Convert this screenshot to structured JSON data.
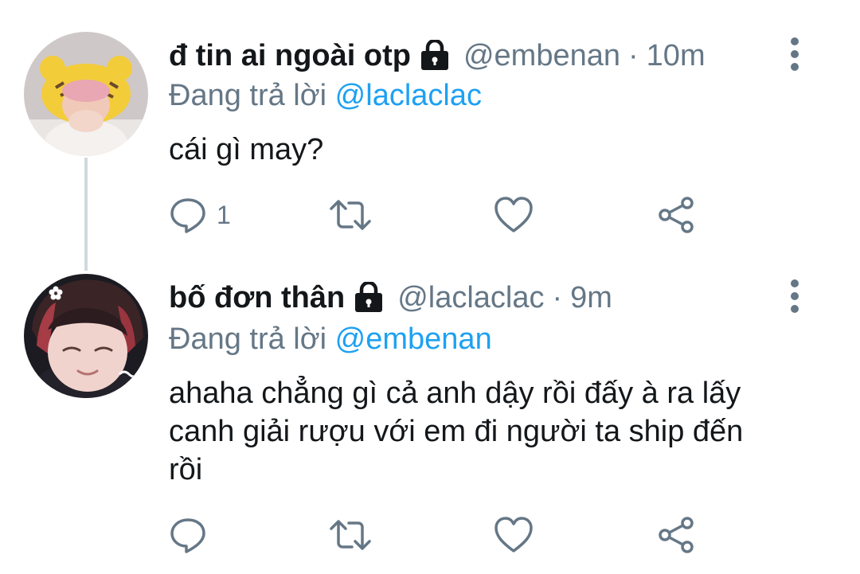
{
  "tweets": [
    {
      "display_name": "đ tin ai ngoài otp",
      "handle": "@embenan",
      "separator": "·",
      "time": "10m",
      "reply_prefix": "Đang trả lời",
      "reply_to": "@laclaclac",
      "text": "cái gì may?",
      "reply_count": "1",
      "protected": true,
      "icons": {
        "lock": "lock-icon",
        "more": "more-vertical-icon",
        "reply": "reply-icon",
        "retweet": "retweet-icon",
        "like": "heart-icon",
        "share": "share-icon"
      }
    },
    {
      "display_name": "bố đơn thân",
      "handle": "@laclaclac",
      "separator": "·",
      "time": "9m",
      "reply_prefix": "Đang trả lời",
      "reply_to": "@embenan",
      "text_lines": [
        "ahaha chẳng gì cả anh dậy rồi đấy à ra lấy",
        "canh giải rượu với em đi người ta ship đến",
        "rồi"
      ],
      "reply_count": "",
      "protected": true
    }
  ],
  "colors": {
    "name": "#14171a",
    "muted": "#657786",
    "mention": "#1da1f2",
    "thread_line": "#cfd9de"
  }
}
